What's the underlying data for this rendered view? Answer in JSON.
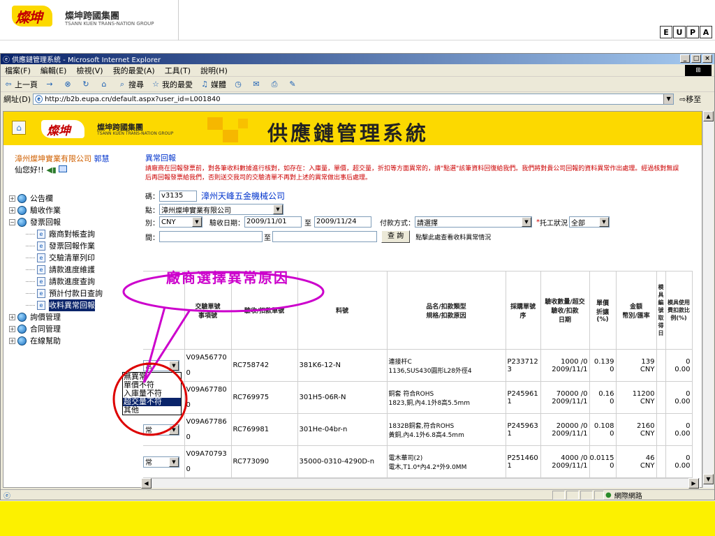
{
  "slide": {
    "logo": "燦坤",
    "company": "燦坤跨國集團",
    "company_en": "TSANN KUEN TRANS-NATION GROUP",
    "eupa": [
      "E",
      "U",
      "P",
      "A"
    ]
  },
  "window": {
    "title": "供應鏈管理系統 - Microsoft Internet Explorer",
    "controls": [
      "_",
      "□",
      "×"
    ],
    "menu": [
      "檔案(F)",
      "編輯(E)",
      "檢視(V)",
      "我的最愛(A)",
      "工具(T)",
      "說明(H)"
    ],
    "toolbar": [
      "上一頁",
      "→",
      "⊗",
      "↻",
      "⌂",
      "搜尋",
      "我的最愛",
      "媒體"
    ],
    "address_label": "網址(D)",
    "address_value": "http://b2b.eupa.cn/default.aspx?user_id=L001840",
    "go_label": "移至",
    "zone": "網際網路"
  },
  "app": {
    "logo": "燦坤",
    "company": "燦坤跨國集團",
    "company_en": "TSANN KUEN TRANS-NATION GROUP",
    "title": "供應鏈管理系統"
  },
  "sidebar": {
    "company": "漳州燦坤實業有限公司",
    "name": "郭慧",
    "greeting": "仙您好!!",
    "tree": [
      {
        "label": "公告欄",
        "pm": "+"
      },
      {
        "label": "驗收作業",
        "pm": "+"
      },
      {
        "label": "發票回報",
        "pm": "−"
      }
    ],
    "leaves": [
      "廠商對帳查詢",
      "發票回報作業",
      "交驗清單列印",
      "請款進度維護",
      "請款進度查詢",
      "預計付款日查詢",
      "收料異常回報"
    ],
    "tree2": [
      {
        "label": "詢價管理",
        "pm": "+"
      },
      {
        "label": "合同管理",
        "pm": "+"
      },
      {
        "label": "在線幫助",
        "pm": "+"
      }
    ]
  },
  "main": {
    "heading": "異常回報",
    "notice": "請廠商在回報發票前，對各筆收料數據進行核對，如存在：入庫量，單價，超交量，折扣等方面異常的，請\"點選\"該筆資料回復給我們。我們將對貴公司回報的資料異常作出處理。經過核對無誤后再回報發票給我們，否則送交我司的交驗清單不再對上述的異常做出事后處理。",
    "vendor_label": "碼：",
    "vendor_code": "v3135",
    "vendor_name": "漳州天峰五金機械公司",
    "site_label": "點：",
    "site_value": "漳州燦坤實業有限公司",
    "currency_label": "別：",
    "currency_value": "CNY",
    "date_label": "驗收日期：",
    "date_from": "2009/11/01",
    "date_to_label": "至",
    "date_to": "2009/11/24",
    "pay_label": "付款方式：",
    "pay_value": "請選擇",
    "status_label": "托工狀況",
    "status_value": "全部",
    "period_label": "間：",
    "period_to_label": "至",
    "query_button": "查 詢",
    "link_text": "點擊此處查看收料異常情況"
  },
  "table": {
    "headers": [
      "交驗單號\n事項號",
      "驗收/扣款單號",
      "料號",
      "品名/扣款類型\n規格/扣款原因",
      "採購單號\n序",
      "驗收數量/超交\n驗收/扣款\n日期",
      "單價\n折讓\n(%)",
      "金額\n幣別/匯率",
      "模具編號取得日",
      "模具使用費扣款比例(%)"
    ],
    "rows": [
      {
        "sel": "常",
        "jy": "V09A56770",
        "jy2": "0",
        "ys": "RC758742",
        "lh": "381K6-12-N",
        "pm1": "連接杆C",
        "pm2": "1136,SUS430圓形L28外徑4",
        "cg1": "P233712",
        "cg2": "3",
        "qty1": "1000 /0",
        "qty2": "2009/11/1",
        "dj1": "0.139",
        "dj2": "0",
        "je1": "139",
        "je2": "CNY",
        "mj": "",
        "bl1": "0",
        "bl2": "0.00"
      },
      {
        "sel": "",
        "jy": "V09A67780",
        "jy2": "0",
        "ys": "RC769975",
        "lh": "301H5-06R-N",
        "pm1": "銅套 符合ROHS",
        "pm2": "1823,銅,內4.1外8高5.5mm",
        "cg1": "P245961",
        "cg2": "1",
        "qty1": "70000 /0",
        "qty2": "2009/11/1",
        "dj1": "0.16",
        "dj2": "0",
        "je1": "11200",
        "je2": "CNY",
        "mj": "",
        "bl1": "0",
        "bl2": "0.00"
      },
      {
        "sel": "常",
        "jy": "V09A67786",
        "jy2": "0",
        "ys": "RC769981",
        "lh": "301He-04br-n",
        "pm1": "1832B銅套,符合ROHS",
        "pm2": "黃銅,內4.1外6.8高4.5mm",
        "cg1": "P245963",
        "cg2": "1",
        "qty1": "20000 /0",
        "qty2": "2009/11/1",
        "dj1": "0.108",
        "dj2": "0",
        "je1": "2160",
        "je2": "CNY",
        "mj": "",
        "bl1": "0",
        "bl2": "0.00"
      },
      {
        "sel": "常",
        "jy": "V09A70793",
        "jy2": "0",
        "ys": "RC773090",
        "lh": "35000-0310-4290D-n",
        "pm1": "電木華司(2)",
        "pm2": "電木,T1.0*內4.2*外9.0MM",
        "cg1": "P251460",
        "cg2": "1",
        "qty1": "4000 /0",
        "qty2": "2009/11/1",
        "dj1": "0.0115",
        "dj2": "0",
        "je1": "46",
        "je2": "CNY",
        "mj": "",
        "bl1": "0",
        "bl2": "0.00"
      }
    ]
  },
  "dropdown": {
    "options": [
      "無異常",
      "單價不符",
      "入庫量不符",
      "超交量不符",
      "其他"
    ],
    "selected_index": 3
  },
  "annotation": {
    "callout": "廠商選擇異常原因",
    "callout_color": "#cc00cc",
    "circle_color": "#dd0000"
  },
  "colors": {
    "brand_yellow": "#fcd900",
    "brand_red": "#c40000",
    "link_blue": "#0033cc",
    "notice_red": "#cc0000"
  }
}
